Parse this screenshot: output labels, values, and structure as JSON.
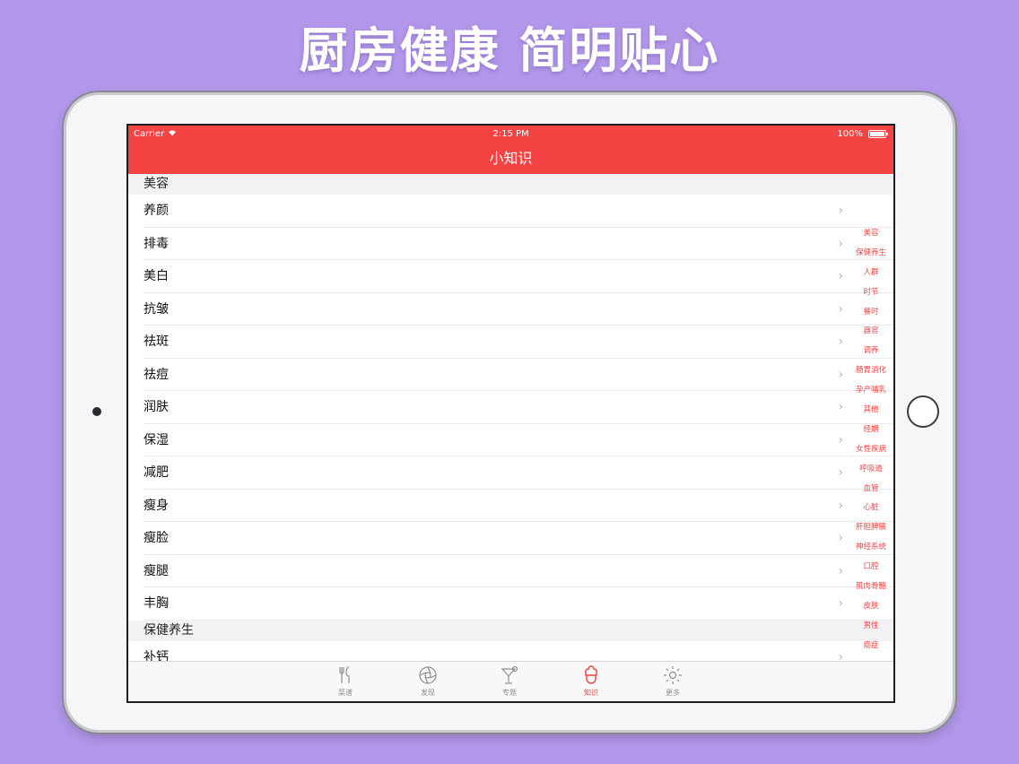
{
  "headline": "厨房健康 简明贴心",
  "status_bar": {
    "carrier": "Carrier",
    "time": "2:15 PM",
    "battery": "100%"
  },
  "nav": {
    "title": "小知识"
  },
  "sections": [
    {
      "header": "美容",
      "items": [
        "养颜",
        "排毒",
        "美白",
        "抗皱",
        "祛斑",
        "祛痘",
        "润肤",
        "保湿",
        "减肥",
        "瘦身",
        "瘦脸",
        "瘦腿",
        "丰胸"
      ]
    },
    {
      "header": "保健养生",
      "items": [
        "补钙"
      ]
    }
  ],
  "chevron": "›",
  "index": [
    "美容",
    "保健养生",
    "人群",
    "时节",
    "餐时",
    "器官",
    "调养",
    "肠胃消化",
    "孕产哺乳",
    "其他",
    "经期",
    "女性疾病",
    "呼吸道",
    "血管",
    "心脏",
    "肝胆脾胰",
    "神经系统",
    "口腔",
    "肌肉骨骼",
    "皮肤",
    "男性",
    "癌症"
  ],
  "tabs": [
    {
      "label": "菜谱",
      "icon": "fork-knife-icon"
    },
    {
      "label": "发现",
      "icon": "aperture-icon"
    },
    {
      "label": "专题",
      "icon": "cocktail-icon"
    },
    {
      "label": "知识",
      "icon": "chef-icon"
    },
    {
      "label": "更多",
      "icon": "gear-icon"
    }
  ],
  "colors": {
    "accent": "#f34343",
    "background": "#b196e9"
  }
}
